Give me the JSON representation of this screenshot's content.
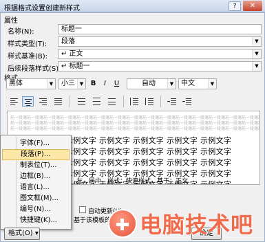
{
  "window": {
    "title": "根据格式设置创建新样式",
    "help": "?",
    "close": "✕"
  },
  "properties": {
    "section_label": "属性",
    "name_label": "名称(N):",
    "name_value": "标题一",
    "type_label": "样式类型(T):",
    "type_value": "段落",
    "based_on_label": "样式基准(B):",
    "based_on_value": "↵ 正文",
    "next_label": "后续段落样式(S):",
    "next_value": "↵ 标题一"
  },
  "format": {
    "section_label": "格式",
    "font": "黑体",
    "size": "小三",
    "bold": "B",
    "italic": "I",
    "underline": "U",
    "color": "自动",
    "language": "中文"
  },
  "preview": {
    "prev_text": "前一段落前一段落前一段落前一段落前一段落前一段落前一段落前一段落前一段落前一段落前一段落前一段落前一段落前一段落前一段落前一段落",
    "sample_lines": [
      "示例文字   示例文字   示例文字   示例文字   示例文字",
      "示例文字   示例文字   示例文字   示例文字   示例文字",
      "示例文字   示例文字   示例文字   示例文字   示例文字",
      "示例文字   示例文字   示例文字   示例文字   示例文字",
      "示例文字   示例文字   示例文字   示例文字   示例文字"
    ]
  },
  "description": "左，居中，样式：快速样式，基于：正文",
  "options": {
    "auto_update": "自动更新(U)",
    "new_docs": "基于该模板的新文档"
  },
  "menu": {
    "items": [
      {
        "label": "字体(F)..."
      },
      {
        "label": "段落(P)..."
      },
      {
        "label": "制表位(T)..."
      },
      {
        "label": "边框(B)..."
      },
      {
        "label": "语言(L)..."
      },
      {
        "label": "图文框(M)..."
      },
      {
        "label": "编号(N)..."
      },
      {
        "label": "快捷键(K)..."
      }
    ]
  },
  "buttons": {
    "format": "格式(O) ▾",
    "ok": "确定"
  },
  "watermark": {
    "text": "电脑技术吧"
  },
  "colors": {
    "highlight": "#fce6a8",
    "watermark": "#f06a4c"
  }
}
